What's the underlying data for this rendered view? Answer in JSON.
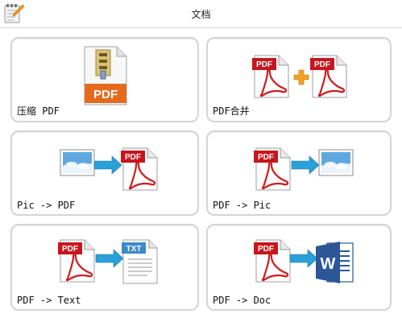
{
  "header": {
    "title": "文档",
    "app_icon": "notepad-pencil-icon"
  },
  "tiles": [
    {
      "label": "压缩 PDF",
      "icon": "compress-pdf-icon",
      "pdf_badge": "PDF"
    },
    {
      "label": "PDF合并",
      "icon": "merge-pdf-icon",
      "pdf_badge": "PDF"
    },
    {
      "label": "Pic -> PDF",
      "icon": "image-to-pdf-icon",
      "pdf_badge": "PDF"
    },
    {
      "label": "PDF -> Pic",
      "icon": "pdf-to-image-icon",
      "pdf_badge": "PDF"
    },
    {
      "label": "PDF -> Text",
      "icon": "pdf-to-text-icon",
      "pdf_badge": "PDF",
      "txt_badge": "TXT"
    },
    {
      "label": "PDF -> Doc",
      "icon": "pdf-to-doc-icon",
      "pdf_badge": "PDF",
      "doc_letter": "W"
    }
  ],
  "colors": {
    "pdf_red": "#c8161d",
    "acrobat_red": "#d11a1a",
    "arrow_blue": "#2a9fd8",
    "plus_orange": "#f0a020",
    "word_blue": "#2b5797",
    "txt_blue": "#3e89c9",
    "tile_border": "#d4d4d4"
  }
}
